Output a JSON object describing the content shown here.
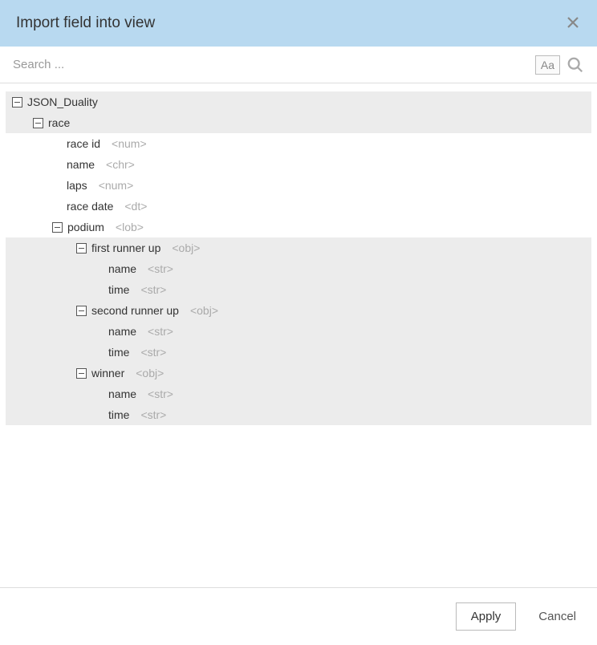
{
  "header": {
    "title": "Import field into view"
  },
  "search": {
    "placeholder": "Search ...",
    "aa_label": "Aa"
  },
  "tree": {
    "root": {
      "label": "JSON_Duality",
      "children": {
        "race": {
          "label": "race",
          "fields": {
            "race_id": {
              "label": "race id",
              "type": "<num>"
            },
            "name": {
              "label": "name",
              "type": "<chr>"
            },
            "laps": {
              "label": "laps",
              "type": "<num>"
            },
            "race_date": {
              "label": "race date",
              "type": "<dt>"
            }
          },
          "podium": {
            "label": "podium",
            "type": "<lob>",
            "first_runner_up": {
              "label": "first runner up",
              "type": "<obj>",
              "name": {
                "label": "name",
                "type": "<str>"
              },
              "time": {
                "label": "time",
                "type": "<str>"
              }
            },
            "second_runner_up": {
              "label": "second runner up",
              "type": "<obj>",
              "name": {
                "label": "name",
                "type": "<str>"
              },
              "time": {
                "label": "time",
                "type": "<str>"
              }
            },
            "winner": {
              "label": "winner",
              "type": "<obj>",
              "name": {
                "label": "name",
                "type": "<str>"
              },
              "time": {
                "label": "time",
                "type": "<str>"
              }
            }
          }
        }
      }
    }
  },
  "footer": {
    "apply": "Apply",
    "cancel": "Cancel"
  }
}
